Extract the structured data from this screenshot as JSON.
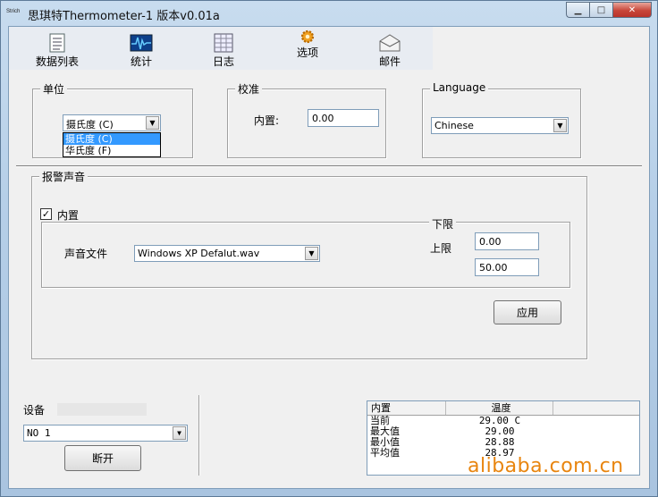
{
  "window": {
    "icon_text": "Strich",
    "title": "思琪特Thermometer-1 版本v0.01a",
    "min_glyph": "▁",
    "max_glyph": "□",
    "close_glyph": "✕"
  },
  "toolbar": {
    "items": [
      {
        "label": "数据列表",
        "icon": "list-icon"
      },
      {
        "label": "统计",
        "icon": "pulse-chart-icon"
      },
      {
        "label": "日志",
        "icon": "grid-log-icon"
      },
      {
        "label": "选项",
        "icon": "gear-icon"
      },
      {
        "label": "邮件",
        "icon": "envelope-icon"
      }
    ]
  },
  "unit": {
    "legend": "单位",
    "selected": "摄氏度 (C)",
    "options": [
      "摄氏度 (C)",
      "华氏度 (F)"
    ]
  },
  "calibration": {
    "legend": "校准",
    "label": "内置:",
    "value": "0.00"
  },
  "language": {
    "legend": "Language",
    "selected": "Chinese"
  },
  "alarm": {
    "legend": "报警声音",
    "builtin_label": "内置",
    "builtin_checked": true,
    "sound_file_label": "声音文件",
    "sound_file": "Windows XP Defalut.wav",
    "lower_label": "下限",
    "upper_label": "上限",
    "lower_value": "0.00",
    "upper_value": "50.00",
    "apply_label": "应用"
  },
  "device": {
    "label": "设备",
    "selected": "NO 1",
    "disconnect_label": "断开"
  },
  "readings": {
    "headers": [
      "内置",
      "温度"
    ],
    "rows": [
      {
        "name": "当前",
        "value": "29.00 C"
      },
      {
        "name": "最大值",
        "value": "29.00"
      },
      {
        "name": "最小值",
        "value": "28.88"
      },
      {
        "name": "平均值",
        "value": "28.97"
      }
    ]
  },
  "watermark": "alibaba.com.cn"
}
